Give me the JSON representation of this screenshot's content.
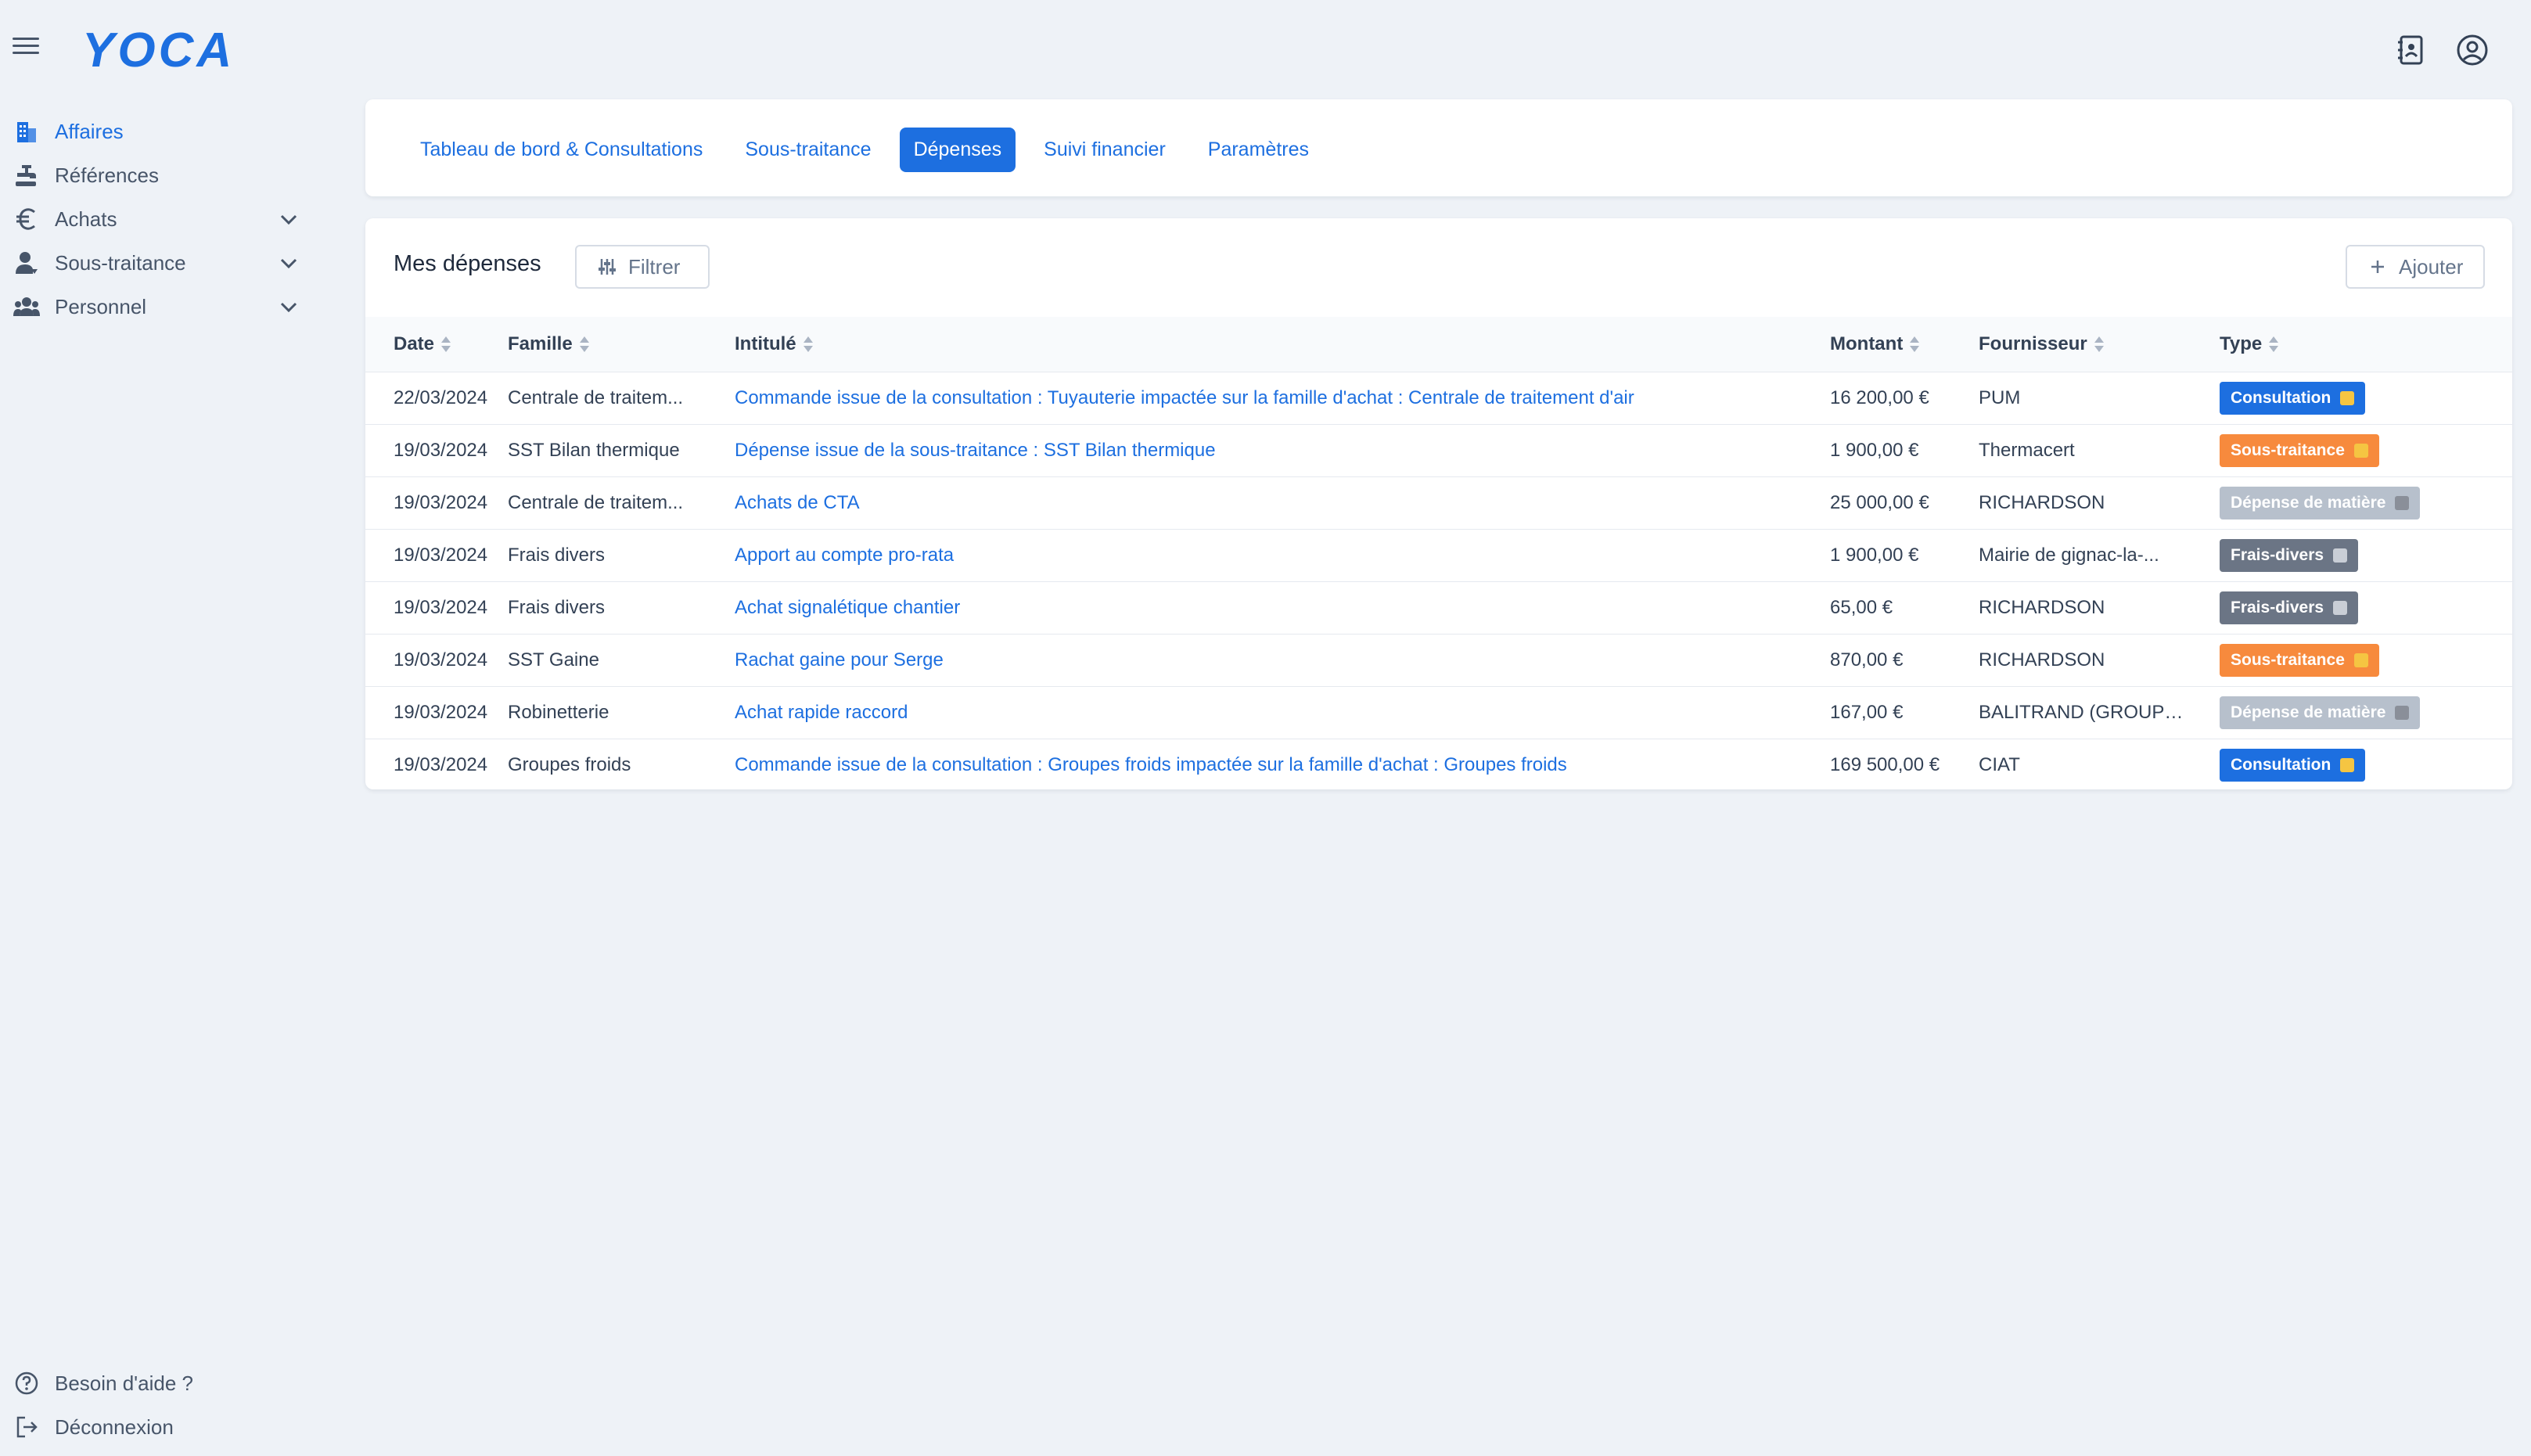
{
  "app": {
    "logo": "YOCA"
  },
  "sidebar": {
    "items": [
      {
        "label": "Affaires",
        "icon": "building-icon",
        "active": true,
        "expandable": false
      },
      {
        "label": "Références",
        "icon": "tap-icon",
        "active": false,
        "expandable": false
      },
      {
        "label": "Achats",
        "icon": "euro-icon",
        "active": false,
        "expandable": true
      },
      {
        "label": "Sous-traitance",
        "icon": "person-icon",
        "active": false,
        "expandable": true
      },
      {
        "label": "Personnel",
        "icon": "people-icon",
        "active": false,
        "expandable": true
      }
    ],
    "bottom": [
      {
        "label": "Besoin d'aide ?",
        "icon": "help-icon"
      },
      {
        "label": "Déconnexion",
        "icon": "logout-icon"
      }
    ]
  },
  "tabs": [
    {
      "label": "Tableau de bord & Consultations",
      "active": false
    },
    {
      "label": "Sous-traitance",
      "active": false
    },
    {
      "label": "Dépenses",
      "active": true
    },
    {
      "label": "Suivi financier",
      "active": false
    },
    {
      "label": "Paramètres",
      "active": false
    }
  ],
  "card": {
    "title": "Mes dépenses",
    "filter_label": "Filtrer",
    "add_label": "Ajouter"
  },
  "table": {
    "columns": [
      "Date",
      "Famille",
      "Intitulé",
      "Montant",
      "Fournisseur",
      "Type"
    ],
    "rows": [
      {
        "date": "22/03/2024",
        "famille": "Centrale de traitem...",
        "intitule": "Commande issue de la consultation : Tuyauterie impactée sur la famille d'achat : Centrale de traitement d'air",
        "montant": "16 200,00 €",
        "fournisseur": "PUM",
        "type": "Consultation",
        "type_key": "consultation"
      },
      {
        "date": "19/03/2024",
        "famille": "SST Bilan thermique",
        "intitule": "Dépense issue de la sous-traitance : SST Bilan thermique",
        "montant": "1 900,00 €",
        "fournisseur": "Thermacert",
        "type": "Sous-traitance",
        "type_key": "sous-traitance"
      },
      {
        "date": "19/03/2024",
        "famille": "Centrale de traitem...",
        "intitule": "Achats de CTA",
        "montant": "25 000,00 €",
        "fournisseur": "RICHARDSON",
        "type": "Dépense de matière",
        "type_key": "matiere"
      },
      {
        "date": "19/03/2024",
        "famille": "Frais divers",
        "intitule": "Apport au compte pro-rata",
        "montant": "1 900,00 €",
        "fournisseur": "Mairie de gignac-la-...",
        "type": "Frais-divers",
        "type_key": "frais"
      },
      {
        "date": "19/03/2024",
        "famille": "Frais divers",
        "intitule": "Achat signalétique chantier",
        "montant": "65,00 €",
        "fournisseur": "RICHARDSON",
        "type": "Frais-divers",
        "type_key": "frais"
      },
      {
        "date": "19/03/2024",
        "famille": "SST Gaine",
        "intitule": "Rachat gaine pour Serge",
        "montant": "870,00 €",
        "fournisseur": "RICHARDSON",
        "type": "Sous-traitance",
        "type_key": "sous-traitance"
      },
      {
        "date": "19/03/2024",
        "famille": "Robinetterie",
        "intitule": "Achat rapide raccord",
        "montant": "167,00 €",
        "fournisseur": "BALITRAND (GROUPE ...",
        "type": "Dépense de matière",
        "type_key": "matiere"
      },
      {
        "date": "19/03/2024",
        "famille": "Groupes froids",
        "intitule": "Commande issue de la consultation : Groupes froids impactée sur la famille d'achat : Groupes froids",
        "montant": "169 500,00 €",
        "fournisseur": "CIAT",
        "type": "Consultation",
        "type_key": "consultation"
      }
    ]
  },
  "colors": {
    "accent": "#1d6fe0",
    "consultation": "#1d6fe0",
    "sous-traitance": "#f78a3d",
    "matiere": "#b7c0cc",
    "frais": "#6b7585"
  },
  "type_icon_colors": {
    "consultation": "#f5c542",
    "sous-traitance": "#f5c542",
    "matiere": "#8a8f99",
    "frais": "#c9ced6"
  }
}
